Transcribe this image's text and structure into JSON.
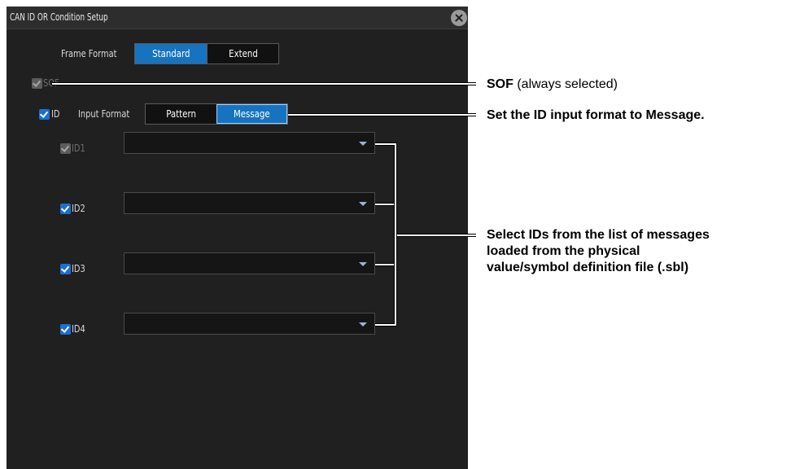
{
  "window": {
    "title": "CAN ID OR Condition Setup"
  },
  "frame_format": {
    "label": "Frame Format",
    "options": [
      "Standard",
      "Extend"
    ],
    "selected": "Standard"
  },
  "sof": {
    "label": "SOF",
    "checked": true,
    "enabled": false
  },
  "id": {
    "label": "ID",
    "checked": true,
    "input_format_label": "Input Format",
    "input_format_options": [
      "Pattern",
      "Message"
    ],
    "input_format_selected": "Message"
  },
  "id_rows": [
    {
      "label": "ID1",
      "checked": true,
      "enabled": false,
      "value": ""
    },
    {
      "label": "ID2",
      "checked": true,
      "enabled": true,
      "value": ""
    },
    {
      "label": "ID3",
      "checked": true,
      "enabled": true,
      "value": ""
    },
    {
      "label": "ID4",
      "checked": true,
      "enabled": true,
      "value": ""
    }
  ],
  "annotations": {
    "sof_bold": "SOF",
    "sof_rest": " (always selected)",
    "id_format": "Set the ID input format to Message.",
    "select_line1": "Select IDs from the list of messages",
    "select_line2": "loaded from the physical",
    "select_line3": "value/symbol definition file (.sbl)"
  },
  "colors": {
    "panel_bg": "#202020",
    "accent": "#1673c0",
    "checkbox": "#1b6fd0"
  },
  "icons": {
    "close": "close-icon",
    "dropdown": "chevron-down-icon"
  }
}
